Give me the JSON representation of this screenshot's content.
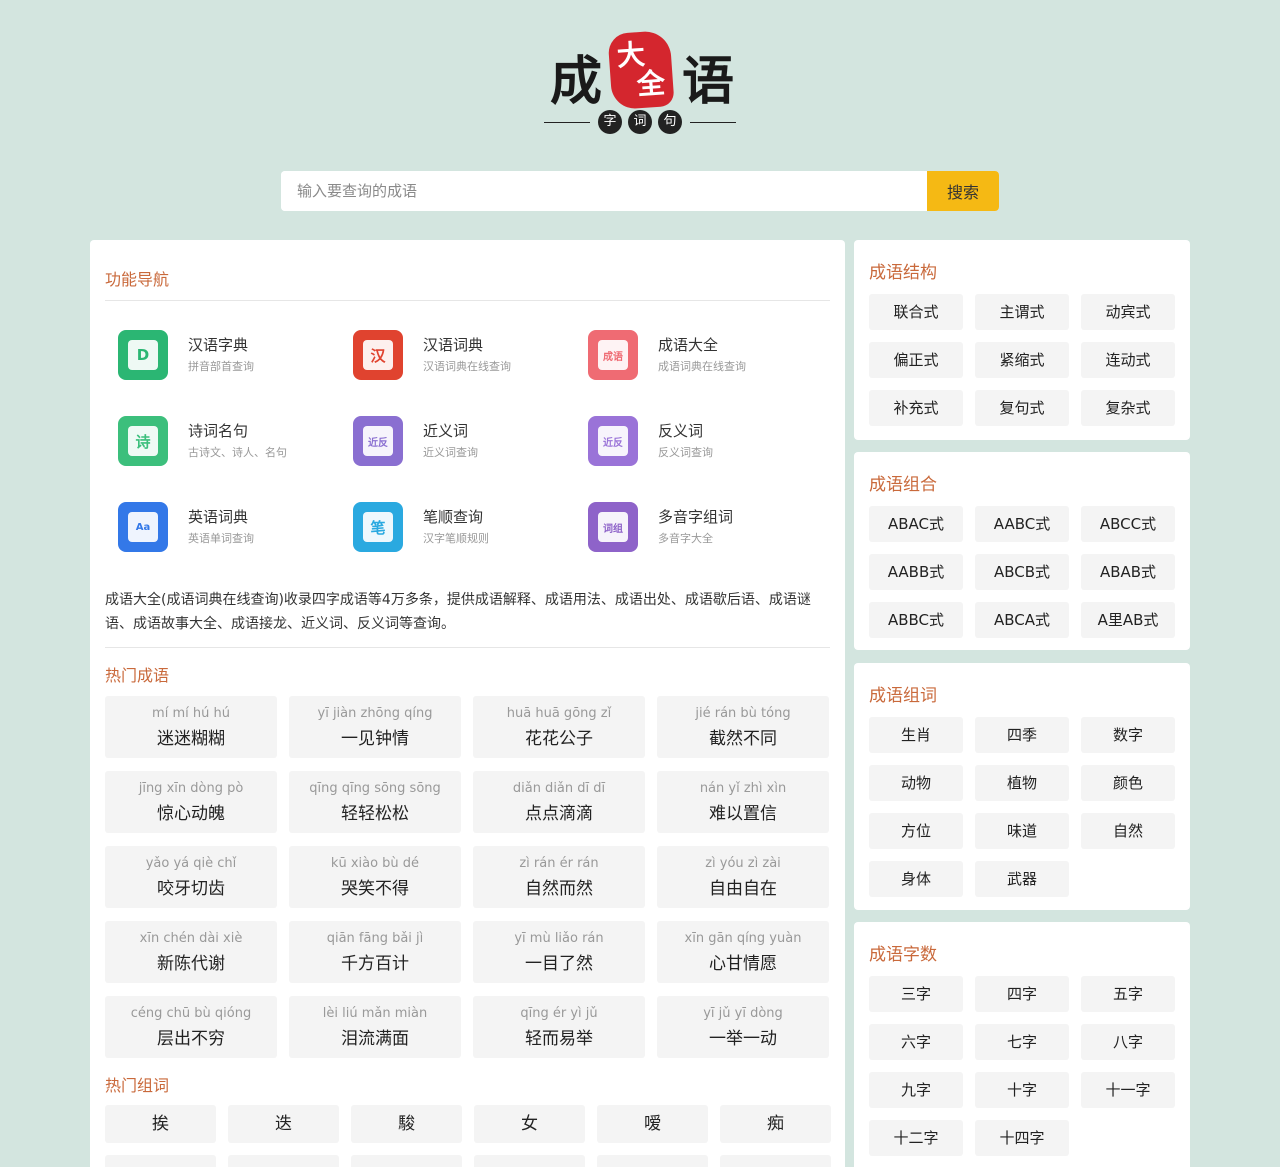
{
  "logo": {
    "left_char": "成",
    "right_char": "语",
    "seal_top": "大",
    "seal_bottom": "全",
    "sub": [
      "字",
      "词",
      "句"
    ]
  },
  "search": {
    "placeholder": "输入要查询的成语",
    "button_label": "搜索"
  },
  "nav": {
    "title": "功能导航",
    "items": [
      {
        "name": "汉语字典",
        "desc": "拼音部首查询",
        "glyph": "D",
        "color": "#2bb673",
        "icon": "dictionary-icon"
      },
      {
        "name": "汉语词典",
        "desc": "汉语词典在线查询",
        "glyph": "汉",
        "color": "#e0432f",
        "icon": "cidian-icon"
      },
      {
        "name": "成语大全",
        "desc": "成语词典在线查询",
        "glyph": "成语",
        "color": "#ef6b73",
        "icon": "chengyu-icon"
      },
      {
        "name": "诗词名句",
        "desc": "古诗文、诗人、名句",
        "glyph": "诗",
        "color": "#3cbf7c",
        "icon": "poetry-icon"
      },
      {
        "name": "近义词",
        "desc": "近义词查询",
        "glyph": "近反",
        "color": "#8a6fd1",
        "icon": "synonym-icon"
      },
      {
        "name": "反义词",
        "desc": "反义词查询",
        "glyph": "近反",
        "color": "#9a73d8",
        "icon": "antonym-icon"
      },
      {
        "name": "英语词典",
        "desc": "英语单词查询",
        "glyph": "Aa",
        "color": "#3378e8",
        "icon": "english-icon"
      },
      {
        "name": "笔顺查询",
        "desc": "汉字笔顺规则",
        "glyph": "笔",
        "color": "#2aa9e0",
        "icon": "stroke-icon"
      },
      {
        "name": "多音字组词",
        "desc": "多音字大全",
        "glyph": "词组",
        "color": "#8e63c9",
        "icon": "polyphone-icon"
      }
    ]
  },
  "intro": "成语大全(成语词典在线查询)收录四字成语等4万多条，提供成语解释、成语用法、成语出处、成语歇后语、成语谜语、成语故事大全、成语接龙、近义词、反义词等查询。",
  "hot_idioms": {
    "title": "热门成语",
    "items": [
      {
        "pinyin": "mí mí hú hú",
        "text": "迷迷糊糊"
      },
      {
        "pinyin": "yī jiàn zhōng qíng",
        "text": "一见钟情"
      },
      {
        "pinyin": "huā huā gōng zǐ",
        "text": "花花公子"
      },
      {
        "pinyin": "jié rán bù tóng",
        "text": "截然不同"
      },
      {
        "pinyin": "jīng xīn dòng pò",
        "text": "惊心动魄"
      },
      {
        "pinyin": "qīng qīng sōng sōng",
        "text": "轻轻松松"
      },
      {
        "pinyin": "diǎn diǎn dī dī",
        "text": "点点滴滴"
      },
      {
        "pinyin": "nán yǐ zhì xìn",
        "text": "难以置信"
      },
      {
        "pinyin": "yǎo yá qiè chǐ",
        "text": "咬牙切齿"
      },
      {
        "pinyin": "kū xiào bù dé",
        "text": "哭笑不得"
      },
      {
        "pinyin": "zì rán ér rán",
        "text": "自然而然"
      },
      {
        "pinyin": "zì yóu zì zài",
        "text": "自由自在"
      },
      {
        "pinyin": "xīn chén dài xiè",
        "text": "新陈代谢"
      },
      {
        "pinyin": "qiān fāng bǎi jì",
        "text": "千方百计"
      },
      {
        "pinyin": "yī mù liǎo rán",
        "text": "一目了然"
      },
      {
        "pinyin": "xīn gān qíng yuàn",
        "text": "心甘情愿"
      },
      {
        "pinyin": "céng chū bù qióng",
        "text": "层出不穷"
      },
      {
        "pinyin": "lèi liú mǎn miàn",
        "text": "泪流满面"
      },
      {
        "pinyin": "qīng ér yì jǔ",
        "text": "轻而易举"
      },
      {
        "pinyin": "yī jǔ yī dòng",
        "text": "一举一动"
      }
    ]
  },
  "hot_words": {
    "title": "热门组词",
    "items": [
      "挨",
      "迭",
      "駿",
      "女",
      "嗳",
      "痴"
    ]
  },
  "structure": {
    "title": "成语结构",
    "items": [
      "联合式",
      "主谓式",
      "动宾式",
      "偏正式",
      "紧缩式",
      "连动式",
      "补充式",
      "复句式",
      "复杂式"
    ]
  },
  "combination": {
    "title": "成语组合",
    "items": [
      "ABAC式",
      "AABC式",
      "ABCC式",
      "AABB式",
      "ABCB式",
      "ABAB式",
      "ABBC式",
      "ABCA式",
      "A里AB式"
    ]
  },
  "wordgroup": {
    "title": "成语组词",
    "items": [
      "生肖",
      "四季",
      "数字",
      "动物",
      "植物",
      "颜色",
      "方位",
      "味道",
      "自然",
      "身体",
      "武器"
    ]
  },
  "charcount": {
    "title": "成语字数",
    "items": [
      "三字",
      "四字",
      "五字",
      "六字",
      "七字",
      "八字",
      "九字",
      "十字",
      "十一字",
      "十二字",
      "十四字"
    ]
  }
}
